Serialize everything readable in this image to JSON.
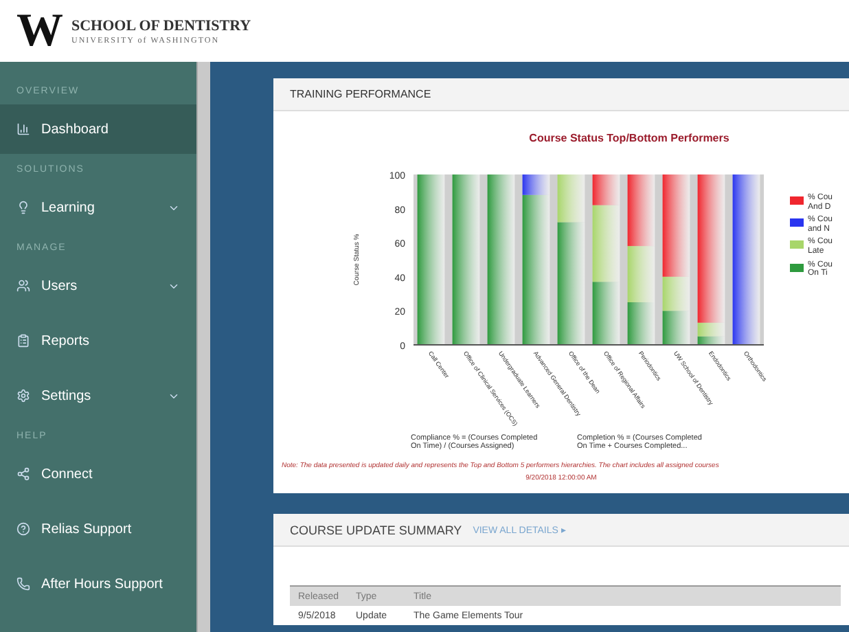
{
  "header": {
    "logo_letter": "W",
    "school": "SCHOOL OF DENTISTRY",
    "university": "UNIVERSITY of WASHINGTON"
  },
  "sidebar": {
    "sections": [
      {
        "heading": "OVERVIEW",
        "items": [
          {
            "label": "Dashboard",
            "kind": "chart",
            "selected": true,
            "expandable": false
          }
        ]
      },
      {
        "heading": "SOLUTIONS",
        "items": [
          {
            "label": "Learning",
            "kind": "bulb",
            "selected": false,
            "expandable": true
          }
        ]
      },
      {
        "heading": "MANAGE",
        "items": [
          {
            "label": "Users",
            "kind": "users",
            "selected": false,
            "expandable": true
          },
          {
            "label": "Reports",
            "kind": "reports",
            "selected": false,
            "expandable": false
          },
          {
            "label": "Settings",
            "kind": "gear",
            "selected": false,
            "expandable": true
          }
        ]
      },
      {
        "heading": "HELP",
        "items": [
          {
            "label": "Connect",
            "kind": "share",
            "selected": false,
            "expandable": false
          },
          {
            "label": "Relias Support",
            "kind": "help",
            "selected": false,
            "expandable": false
          },
          {
            "label": "After Hours Support",
            "kind": "phone",
            "selected": false,
            "expandable": false
          }
        ]
      }
    ]
  },
  "training_panel": {
    "title": "TRAINING PERFORMANCE",
    "chart_data": {
      "type": "bar",
      "stacked": true,
      "title": "Course Status Top/Bottom Performers",
      "ylabel": "Course Status %",
      "ylim": [
        0,
        100
      ],
      "yticks": [
        0,
        20,
        40,
        60,
        80,
        100
      ],
      "categories": [
        "Call Center",
        "Office of Clinical Services (OCS)",
        "Undergraduate Learners",
        "Advanced General Dentistry",
        "Office of the Dean",
        "Office of Regional Affairs",
        "Periodontics",
        "UW School of Dentistry",
        "Endodontics",
        "Orthodontics"
      ],
      "series": [
        {
          "name": "% Cou On Ti",
          "color": "#2e9a3e",
          "values": [
            100,
            100,
            100,
            88,
            72,
            37,
            25,
            20,
            5,
            0
          ]
        },
        {
          "name": "% Cou Late",
          "color": "#a8d66a",
          "values": [
            0,
            0,
            0,
            0,
            28,
            45,
            33,
            20,
            8,
            0
          ]
        },
        {
          "name": "% Cou and N",
          "color": "#2a35f0",
          "values": [
            0,
            0,
            0,
            12,
            0,
            0,
            0,
            0,
            0,
            100
          ]
        },
        {
          "name": "% Cou And D",
          "color": "#f0262e",
          "values": [
            0,
            0,
            0,
            0,
            0,
            18,
            42,
            60,
            87,
            0
          ]
        }
      ]
    },
    "formulas": [
      "Compliance % = (Courses Completed On Time) / (Courses Assigned)",
      "Completion % = (Courses Completed On Time + Courses Completed..."
    ],
    "note": "Note: The data presented is updated daily and represents the Top and Bottom 5 performers hierarchies. The chart includes all assigned courses",
    "date": "9/20/2018 12:00:00 AM"
  },
  "update_panel": {
    "title": "COURSE UPDATE SUMMARY",
    "link": "VIEW ALL DETAILS ▸",
    "table": {
      "columns": [
        "Released",
        "Type",
        "Title"
      ],
      "rows": [
        [
          "9/5/2018",
          "Update",
          "The Game Elements Tour"
        ]
      ]
    }
  }
}
